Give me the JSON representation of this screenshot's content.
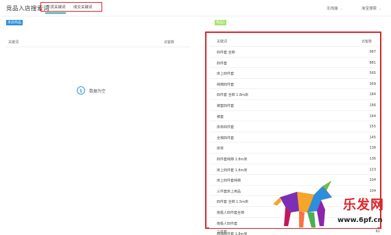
{
  "header": {
    "title": "竞品入店搜索词",
    "tabs": [
      {
        "label": "引流关键词"
      },
      {
        "label": "成交关键词"
      }
    ],
    "dropdowns": [
      {
        "value": "无线端"
      },
      {
        "value": "淘宝搜索"
      }
    ]
  },
  "left_panel": {
    "tag": "本店商品",
    "columns": {
      "keyword": "关键词",
      "visitors": "访客数"
    },
    "empty_text": "数据为空"
  },
  "right_panel": {
    "tag": "竞品1",
    "columns": {
      "keyword": "关键词",
      "visitors": "访客数"
    },
    "rows": [
      {
        "keyword": "四件套 全棉",
        "value": "987"
      },
      {
        "keyword": "四件套",
        "value": "881"
      },
      {
        "keyword": "床上四件套",
        "value": "565"
      },
      {
        "keyword": "纯棉四件套",
        "value": "369"
      },
      {
        "keyword": "四件套 全棉 1.8m床",
        "value": "184"
      },
      {
        "keyword": "被套四件套",
        "value": "166"
      },
      {
        "keyword": "被套",
        "value": "164"
      },
      {
        "keyword": "床单四件套",
        "value": "155"
      },
      {
        "keyword": "全棉四件套",
        "value": "145"
      },
      {
        "keyword": "床单",
        "value": "138"
      },
      {
        "keyword": "四件套纯棉 1.8m床",
        "value": "136"
      },
      {
        "keyword": "床上四件套 1.8m床",
        "value": "123"
      },
      {
        "keyword": "床上四件套纯棉",
        "value": "104"
      },
      {
        "keyword": "三件套床上用品",
        "value": "104"
      },
      {
        "keyword": "四件套 全棉 1.5m床",
        "value": "98"
      },
      {
        "keyword": "南极人四件套全棉",
        "value": ""
      },
      {
        "keyword": "南极人四件套",
        "value": ""
      },
      {
        "keyword": "纯棉四件套 1.8m床",
        "value": ""
      }
    ],
    "partial_row": {
      "keyword": "三件套",
      "value": "61"
    }
  },
  "watermark": {
    "text": "乐发网",
    "url": "www.6pf.cn"
  },
  "colors": {
    "highlight_red": "#d8232a",
    "tag_blue": "#2c8fdb",
    "tag_green": "#a6e36b",
    "tab_underline": "#3aa6a6"
  }
}
